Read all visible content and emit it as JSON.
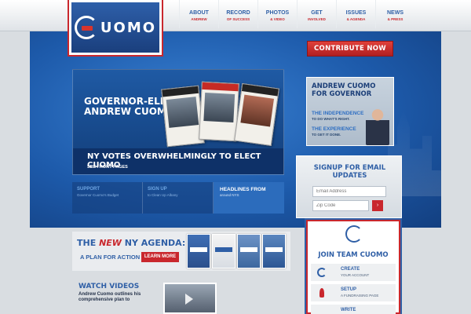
{
  "logo": {
    "text": "UOMO"
  },
  "nav": [
    {
      "label": "ABOUT",
      "sub": "ANDREW"
    },
    {
      "label": "RECORD",
      "sub": "OF SUCCESS"
    },
    {
      "label": "PHOTOS",
      "sub": "& VIDEO"
    },
    {
      "label": "GET",
      "sub": "INVOLVED"
    },
    {
      "label": "ISSUES",
      "sub": "& AGENDA"
    },
    {
      "label": "NEWS",
      "sub": "& PRESS"
    }
  ],
  "contribute_label": "CONTRIBUTE NOW",
  "feature": {
    "title_line1": "GOVERNOR-ELECT",
    "title_line2": "ANDREW CUOMO",
    "headline": "NY VOTES OVERWHELMINGLY TO ELECT CUOMO",
    "link": "SEE FRONT PAGES"
  },
  "gov_card": {
    "line1": "ANDREW CUOMO",
    "line2": "FOR GOVERNOR",
    "independence": "THE INDEPENDENCE",
    "independence_sub": "TO DO WHAT'S RIGHT.",
    "experience": "THE EXPERIENCE",
    "experience_sub": "TO GET IT DONE."
  },
  "quick_links": [
    {
      "title": "SUPPORT",
      "sub": "Governor Cuomo's Budget"
    },
    {
      "title": "SIGN UP",
      "sub": "to Clean Up Albany"
    }
  ],
  "headlines": {
    "title_line1": "HEADLINES FROM",
    "sub": "around NYS"
  },
  "signup": {
    "title": "SIGNUP FOR EMAIL UPDATES",
    "email_placeholder": "Email Address",
    "zip_placeholder": "Zip Code",
    "go": "›"
  },
  "agenda": {
    "the": "THE",
    "new": "NEW",
    "rest": "NY AGENDA:",
    "sub": "A PLAN FOR ACTION",
    "learn": "LEARN MORE"
  },
  "videos": {
    "title": "WATCH VIDEOS",
    "desc": "Andrew Cuomo outlines his comprehensive plan to"
  },
  "team": {
    "title": "JOIN TEAM CUOMO",
    "steps": [
      {
        "title": "CREATE",
        "sub": "YOUR ACCOUNT"
      },
      {
        "title": "SETUP",
        "sub": "A FUNDRAISING PAGE"
      },
      {
        "title": "WRITE",
        "sub": ""
      }
    ]
  },
  "colors": {
    "brand_blue": "#2f5fa6",
    "brand_red": "#c9272d"
  }
}
